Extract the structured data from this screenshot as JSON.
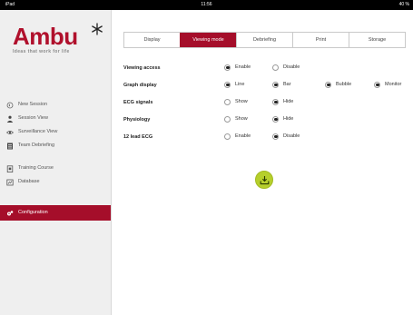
{
  "statusbar": {
    "left": "iPad",
    "time": "11:56",
    "battery": "40 %"
  },
  "brand": {
    "name": "Ambu",
    "tagline": "Ideas that work for life",
    "accent": "#a50e2a"
  },
  "nav": [
    {
      "label": "New Session",
      "icon": "restart-icon"
    },
    {
      "label": "Session View",
      "icon": "person-icon"
    },
    {
      "label": "Surveillance View",
      "icon": "eye-icon"
    },
    {
      "label": "Team Debriefing",
      "icon": "list-icon"
    },
    {
      "label": "Training Course",
      "icon": "clipboard-icon"
    },
    {
      "label": "Database",
      "icon": "database-icon"
    },
    {
      "label": "Configuration",
      "icon": "gears-icon",
      "active": true
    }
  ],
  "tabs": [
    {
      "label": "Display"
    },
    {
      "label": "Viewing mode",
      "active": true
    },
    {
      "label": "Debriefing"
    },
    {
      "label": "Print"
    },
    {
      "label": "Storage"
    }
  ],
  "settings": [
    {
      "label": "Viewing access",
      "options": [
        {
          "label": "Enable",
          "selected": true
        },
        {
          "label": "Disable",
          "selected": false
        }
      ]
    },
    {
      "label": "Graph display",
      "options": [
        {
          "label": "Line",
          "selected": true
        },
        {
          "label": "Bar",
          "selected": true
        },
        {
          "label": "Bubble",
          "selected": true
        },
        {
          "label": "Monitor",
          "selected": true
        }
      ]
    },
    {
      "label": "ECG signals",
      "options": [
        {
          "label": "Show",
          "selected": false
        },
        {
          "label": "Hide",
          "selected": true
        }
      ]
    },
    {
      "label": "Physiology",
      "options": [
        {
          "label": "Show",
          "selected": false
        },
        {
          "label": "Hide",
          "selected": true
        }
      ]
    },
    {
      "label": "12 lead ECG",
      "options": [
        {
          "label": "Enable",
          "selected": false
        },
        {
          "label": "Disable",
          "selected": true
        }
      ]
    }
  ],
  "actions": {
    "download_icon": "download-icon",
    "download_color": "#b6cf2c"
  }
}
